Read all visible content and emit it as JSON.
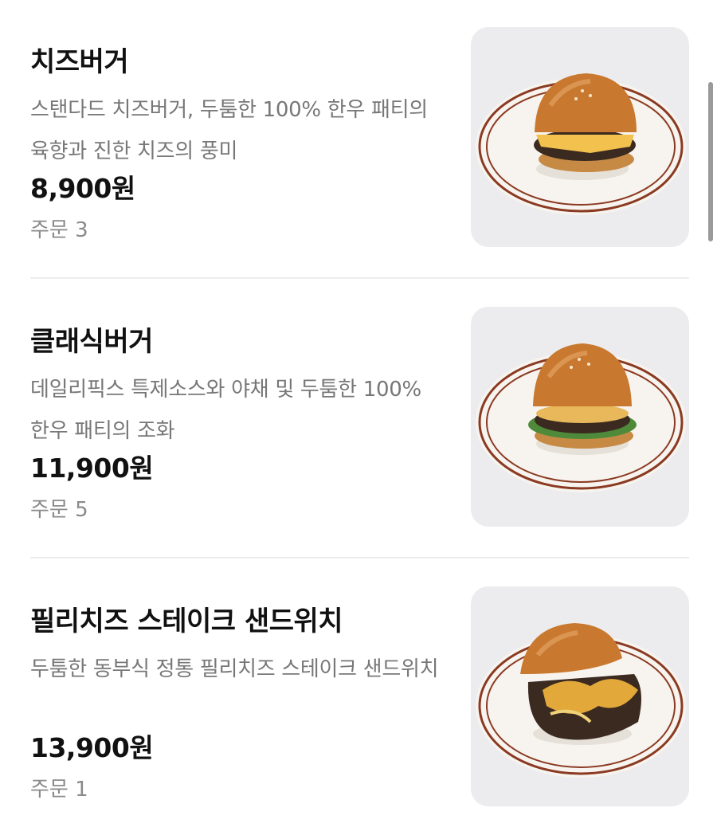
{
  "menu": {
    "items": [
      {
        "name": "치즈버거",
        "description": "스탠다드 치즈버거, 두툼한 100% 한우 패티의 육향과 진한 치즈의 풍미",
        "price": "8,900원",
        "orders": "주문 3",
        "image_icon": "cheeseburger-photo"
      },
      {
        "name": "클래식버거",
        "description": "데일리픽스 특제소스와 야채 및 두툼한 100% 한우 패티의 조화",
        "price": "11,900원",
        "orders": "주문 5",
        "image_icon": "classic-burger-photo"
      },
      {
        "name": "필리치즈 스테이크 샌드위치",
        "description": "두툼한 동부식 정통 필리치즈 스테이크 샌드위치",
        "price": "13,900원",
        "orders": "주문 1",
        "image_icon": "philly-cheese-sandwich-photo"
      }
    ]
  },
  "colors": {
    "title": "#111111",
    "description": "#777777",
    "orders": "#8a8a8a",
    "thumb_bg": "#ececee",
    "plate_rim": "#8b3a22",
    "bun": "#c9792f"
  }
}
